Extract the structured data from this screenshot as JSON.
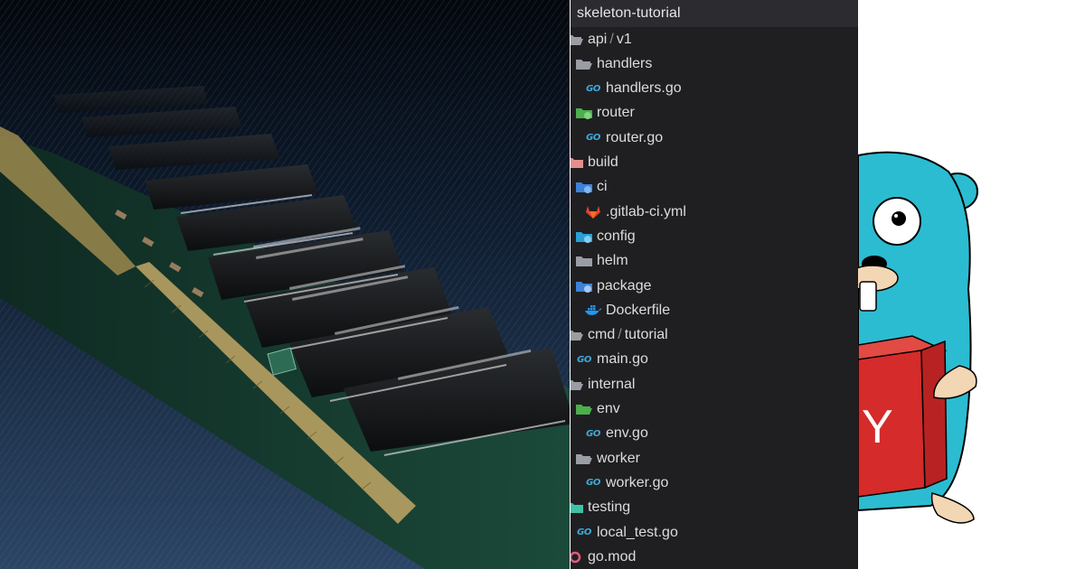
{
  "tree": {
    "root": "skeleton-tutorial",
    "items": [
      {
        "depth": 0,
        "icon": "folder-open-icon",
        "parts": [
          "api",
          "v1"
        ]
      },
      {
        "depth": 1,
        "icon": "folder-open-icon",
        "parts": [
          "handlers"
        ]
      },
      {
        "depth": 2,
        "icon": "go-file-icon",
        "parts": [
          "handlers.go"
        ]
      },
      {
        "depth": 1,
        "icon": "router-folder-icon",
        "parts": [
          "router"
        ]
      },
      {
        "depth": 2,
        "icon": "go-file-icon",
        "parts": [
          "router.go"
        ]
      },
      {
        "depth": 0,
        "icon": "build-folder-icon",
        "parts": [
          "build"
        ]
      },
      {
        "depth": 1,
        "icon": "ci-folder-icon",
        "parts": [
          "ci"
        ]
      },
      {
        "depth": 2,
        "icon": "gitlab-icon",
        "parts": [
          ".gitlab-ci.yml"
        ]
      },
      {
        "depth": 1,
        "icon": "config-folder-icon",
        "parts": [
          "config"
        ]
      },
      {
        "depth": 1,
        "icon": "folder-icon",
        "parts": [
          "helm"
        ]
      },
      {
        "depth": 1,
        "icon": "package-folder-icon",
        "parts": [
          "package"
        ]
      },
      {
        "depth": 2,
        "icon": "docker-icon",
        "parts": [
          "Dockerfile"
        ]
      },
      {
        "depth": 0,
        "icon": "folder-open-icon",
        "parts": [
          "cmd",
          "tutorial"
        ]
      },
      {
        "depth": 1,
        "icon": "go-file-icon",
        "parts": [
          "main.go"
        ]
      },
      {
        "depth": 0,
        "icon": "folder-open-icon",
        "parts": [
          "internal"
        ]
      },
      {
        "depth": 1,
        "icon": "env-folder-icon",
        "parts": [
          "env"
        ]
      },
      {
        "depth": 2,
        "icon": "go-file-icon",
        "parts": [
          "env.go"
        ]
      },
      {
        "depth": 1,
        "icon": "folder-open-icon",
        "parts": [
          "worker"
        ]
      },
      {
        "depth": 2,
        "icon": "go-file-icon",
        "parts": [
          "worker.go"
        ]
      },
      {
        "depth": 0,
        "icon": "testing-folder-icon",
        "parts": [
          "testing"
        ]
      },
      {
        "depth": 1,
        "icon": "go-file-icon",
        "parts": [
          "local_test.go"
        ]
      },
      {
        "depth": 0,
        "icon": "go-mod-icon",
        "parts": [
          "go.mod"
        ]
      }
    ],
    "path_separator": "/",
    "go_icon_text": "GO"
  },
  "gopher": {
    "box_letter": "Y"
  },
  "colors": {
    "tree_bg": "#1f1f22",
    "go_blue": "#3fa9d9",
    "gopher_body": "#2bbcd1",
    "box_red": "#d52b2a"
  }
}
